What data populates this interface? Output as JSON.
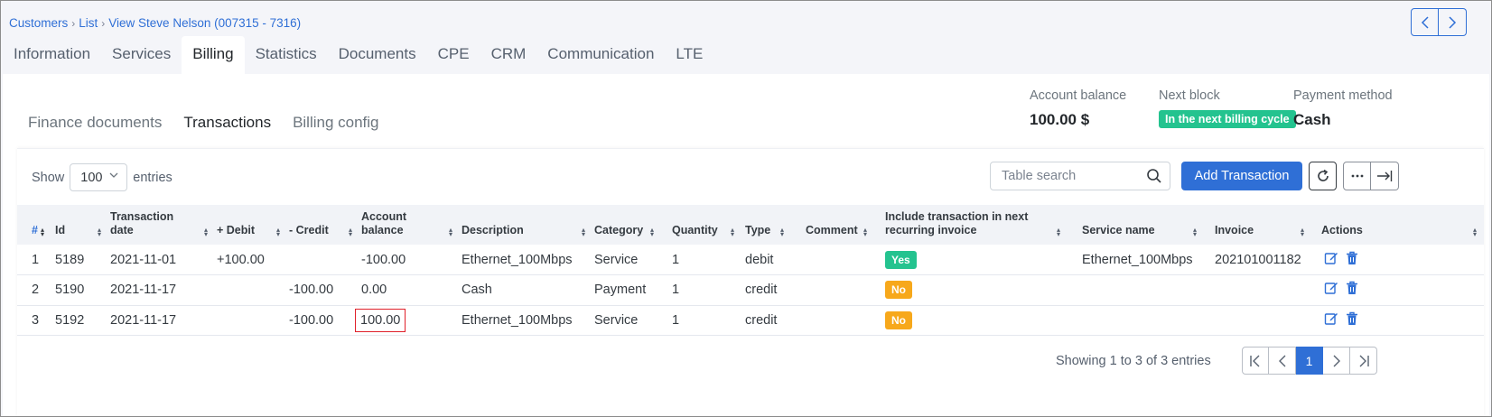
{
  "breadcrumb": {
    "items": [
      "Customers",
      "List",
      "View Steve Nelson (007315 - 7316)"
    ]
  },
  "main_tabs": [
    "Information",
    "Services",
    "Billing",
    "Statistics",
    "Documents",
    "CPE",
    "CRM",
    "Communication",
    "LTE"
  ],
  "active_main_tab": "Billing",
  "sub_tabs": [
    "Finance documents",
    "Transactions",
    "Billing config"
  ],
  "active_sub_tab": "Transactions",
  "summary": {
    "account_balance_label": "Account balance",
    "account_balance_value": "100.00 $",
    "next_block_label": "Next block",
    "next_block_value": "In the next billing cycle",
    "payment_method_label": "Payment method",
    "payment_method_value": "Cash"
  },
  "toolbar": {
    "show_label": "Show",
    "entries_label": "entries",
    "page_size": "100",
    "search_placeholder": "Table search",
    "add_label": "Add Transaction"
  },
  "table": {
    "columns": [
      "#",
      "Id",
      "Transaction date",
      "+ Debit",
      "- Credit",
      "Account balance",
      "Description",
      "Category",
      "Quantity",
      "Type",
      "Comment",
      "Include transaction in next recurring invoice",
      "Service name",
      "Invoice",
      "Actions"
    ],
    "rows": [
      {
        "num": "1",
        "id": "5189",
        "date": "2021-11-01",
        "debit": "+100.00",
        "credit": "",
        "balance": "-100.00",
        "description": "Ethernet_100Mbps",
        "category": "Service",
        "quantity": "1",
        "type": "debit",
        "comment": "",
        "include": "Yes",
        "service": "Ethernet_100Mbps",
        "invoice": "202101001182"
      },
      {
        "num": "2",
        "id": "5190",
        "date": "2021-11-17",
        "debit": "",
        "credit": "-100.00",
        "balance": "0.00",
        "description": "Cash",
        "category": "Payment",
        "quantity": "1",
        "type": "credit",
        "comment": "",
        "include": "No",
        "service": "",
        "invoice": ""
      },
      {
        "num": "3",
        "id": "5192",
        "date": "2021-11-17",
        "debit": "",
        "credit": "-100.00",
        "balance": "100.00",
        "description": "Ethernet_100Mbps",
        "category": "Service",
        "quantity": "1",
        "type": "credit",
        "comment": "",
        "include": "No",
        "service": "",
        "invoice": ""
      }
    ]
  },
  "footer": {
    "info": "Showing 1 to 3 of 3 entries",
    "current_page": "1"
  },
  "colors": {
    "accent": "#2f6fd6",
    "yes": "#24c38f",
    "no": "#f7a81b",
    "highlight": "#e0202a"
  }
}
